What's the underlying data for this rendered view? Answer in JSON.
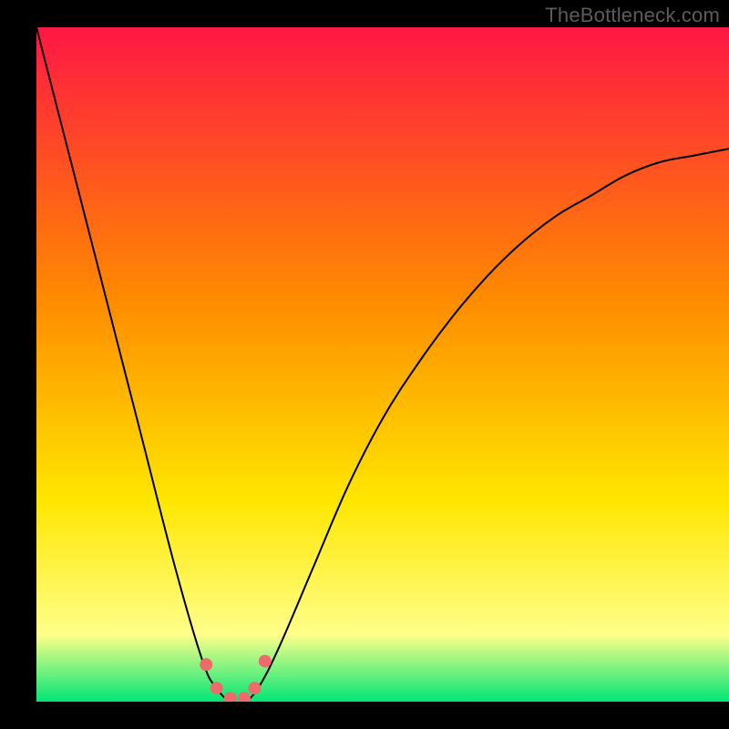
{
  "watermark": "TheBottleneck.com",
  "chart_data": {
    "type": "line",
    "title": "",
    "xlabel": "",
    "ylabel": "",
    "xlim": [
      0,
      100
    ],
    "ylim": [
      0,
      100
    ],
    "background_gradient": {
      "top": "#ff1744",
      "mid1": "#ff8a00",
      "mid2": "#ffe600",
      "mid3": "#ffff8a",
      "bottom": "#00e676"
    },
    "series": [
      {
        "name": "bottleneck-curve",
        "color": "#000000",
        "x": [
          0,
          5,
          10,
          15,
          20,
          24,
          26,
          28,
          30,
          32,
          35,
          40,
          45,
          50,
          55,
          60,
          65,
          70,
          75,
          80,
          85,
          90,
          95,
          100
        ],
        "y": [
          100,
          80,
          60,
          40,
          20,
          6,
          2,
          0,
          0,
          2,
          8,
          20,
          32,
          42,
          50,
          57,
          63,
          68,
          72,
          75,
          78,
          80,
          81,
          82
        ]
      }
    ],
    "markers": {
      "name": "highlight-points",
      "color": "#ef6b6b",
      "x": [
        24.5,
        26,
        28,
        30,
        31.5,
        33
      ],
      "y": [
        5.5,
        2,
        0.5,
        0.5,
        2,
        6
      ]
    }
  }
}
